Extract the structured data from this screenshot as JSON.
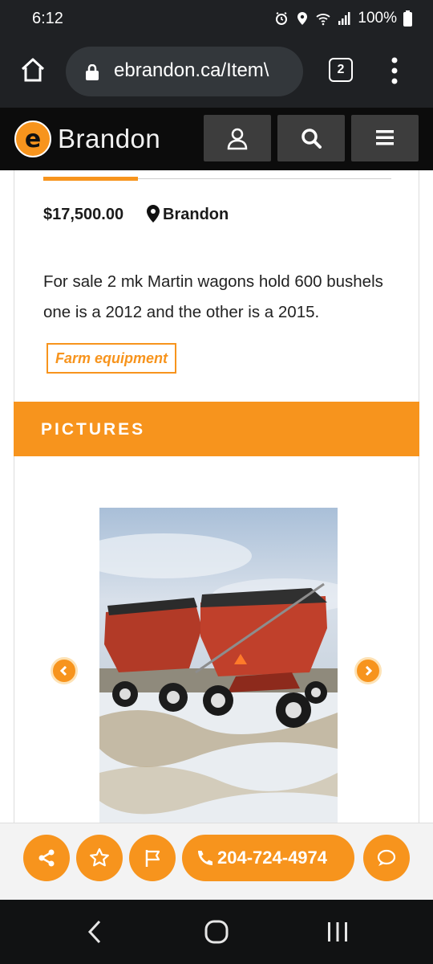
{
  "status_bar": {
    "time": "6:12",
    "battery": "100%",
    "icons": [
      "alarm-icon",
      "location-icon",
      "wifi-icon",
      "signal-icon",
      "battery-icon"
    ]
  },
  "browser": {
    "url": "ebrandon.ca/Item\\",
    "tab_count": "2",
    "icons": [
      "home-icon",
      "lock-icon",
      "more-vertical-icon"
    ]
  },
  "site_header": {
    "logo_letter": "e",
    "logo_text": "Brandon",
    "buttons": [
      "account-icon",
      "search-icon",
      "hamburger-menu-icon"
    ]
  },
  "listing": {
    "price": "$17,500.00",
    "location": "Brandon",
    "description": "For sale 2 mk Martin wagons hold 600 bushels one is a 2012 and the other is a 2015.",
    "category": "Farm equipment",
    "pictures_heading": "PICTURES"
  },
  "gallery": {
    "prev_icon": "chevron-left-icon",
    "next_icon": "chevron-right-icon"
  },
  "actions": {
    "phone": "204-724-4974",
    "icons": [
      "share-icon",
      "star-icon",
      "flag-icon",
      "phone-icon",
      "chat-icon"
    ]
  },
  "colors": {
    "accent": "#f7941d",
    "header_bg": "#0c0c0c",
    "browser_bg": "#1f2124"
  }
}
